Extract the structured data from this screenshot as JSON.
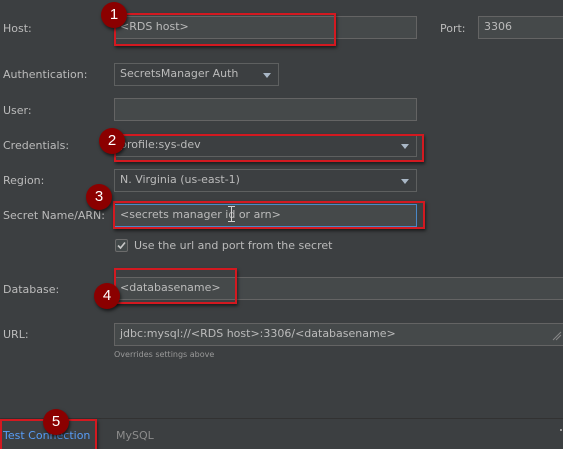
{
  "form": {
    "host_label": "Host:",
    "host_value": "<RDS host>",
    "port_label": "Port:",
    "port_value": "3306",
    "auth_label": "Authentication:",
    "auth_value": "SecretsManager Auth",
    "user_label": "User:",
    "user_value": "",
    "credentials_label": "Credentials:",
    "credentials_value": "profile:sys-dev",
    "region_label": "Region:",
    "region_value": "N. Virginia (us-east-1)",
    "secret_label": "Secret Name/ARN:",
    "secret_value": "<secrets manager id or arn>",
    "use_url_label": "Use the url and port from the secret",
    "use_url_checked": true,
    "database_label": "Database:",
    "database_value": "<databasename>",
    "url_label": "URL:",
    "url_value": "jdbc:mysql://<RDS host>:3306/<databasename>",
    "url_hint": "Overrides settings above"
  },
  "tabs": {
    "test_connection": "Test Connection",
    "mysql": "MySQL"
  },
  "annotations": [
    "1",
    "2",
    "3",
    "4",
    "5"
  ],
  "colors": {
    "background": "#3c3f41",
    "field_bg": "#45494a",
    "annotation_red": "#d31920",
    "badge_fill": "#8b0000",
    "link_blue": "#589df6"
  }
}
